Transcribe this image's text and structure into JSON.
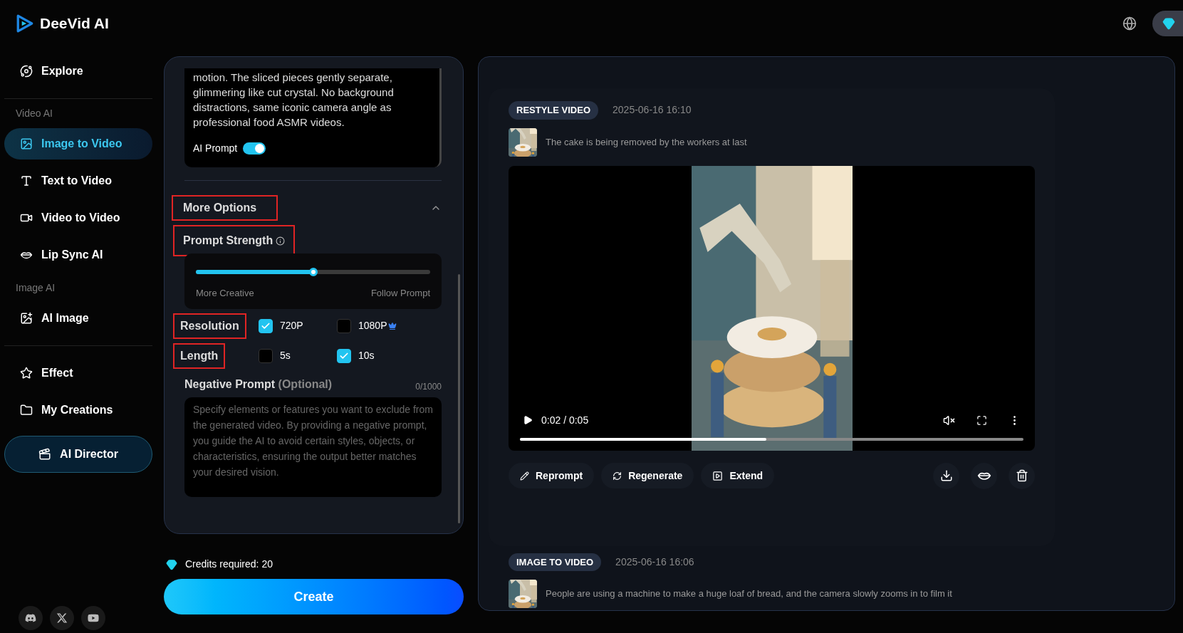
{
  "brand": {
    "name": "DeeVid AI"
  },
  "sidebar": {
    "groups": [
      {
        "items": [
          {
            "label": "Explore",
            "selected": false
          }
        ]
      },
      {
        "heading": "Video AI",
        "items": [
          {
            "label": "Image to Video",
            "selected": true
          },
          {
            "label": "Text to Video",
            "selected": false
          },
          {
            "label": "Video to Video",
            "selected": false
          },
          {
            "label": "Lip Sync AI",
            "selected": false
          }
        ]
      },
      {
        "heading": "Image AI",
        "items": [
          {
            "label": "AI Image",
            "selected": false
          }
        ]
      },
      {
        "items": [
          {
            "label": "Effect",
            "selected": false
          },
          {
            "label": "My Creations",
            "selected": false
          }
        ]
      }
    ],
    "director_button": "AI Director"
  },
  "form": {
    "prompt_text": "motion. The sliced pieces gently separate, glimmering like cut crystal. No background distractions, same iconic camera angle as professional food ASMR videos.",
    "ai_prompt": {
      "label": "AI Prompt",
      "on": true
    },
    "more_options": {
      "label": "More Options",
      "expanded": true,
      "highlighted": true
    },
    "prompt_strength": {
      "label": "Prompt Strength",
      "highlighted": true,
      "level": 0.5,
      "min_label": "More Creative",
      "max_label": "Follow Prompt"
    },
    "options": [
      {
        "label": "Resolution",
        "highlighted": true,
        "choices": [
          {
            "label": "720P",
            "checked": true,
            "premium": false
          },
          {
            "label": "1080P",
            "checked": false,
            "premium": true
          }
        ]
      },
      {
        "label": "Length",
        "highlighted": true,
        "choices": [
          {
            "label": "5s",
            "checked": false,
            "premium": false
          },
          {
            "label": "10s",
            "checked": true,
            "premium": false
          }
        ]
      }
    ],
    "negative_prompt": {
      "label": "Negative Prompt",
      "optional": "(Optional)",
      "count": "0/1000",
      "placeholder": "Specify elements or features you want to exclude from the generated video. By providing a negative prompt, you guide the AI to avoid certain styles, objects, or characteristics, ensuring the output better matches your desired vision."
    },
    "credits": "Credits required: 20",
    "create_button": "Create"
  },
  "history": [
    {
      "badge": "RESTYLE VIDEO",
      "time": "2025-06-16 16:10",
      "description": "The cake is being removed by the workers at last",
      "video": {
        "time": "0:02 / 0:05",
        "level": 0.49,
        "muted": true
      },
      "actions": [
        "Reprompt",
        "Regenerate",
        "Extend"
      ]
    },
    {
      "badge": "IMAGE TO VIDEO",
      "time": "2025-06-16 16:06",
      "description": "People are using a machine to make a huge loaf of bread, and the camera slowly zooms in to film it"
    }
  ]
}
